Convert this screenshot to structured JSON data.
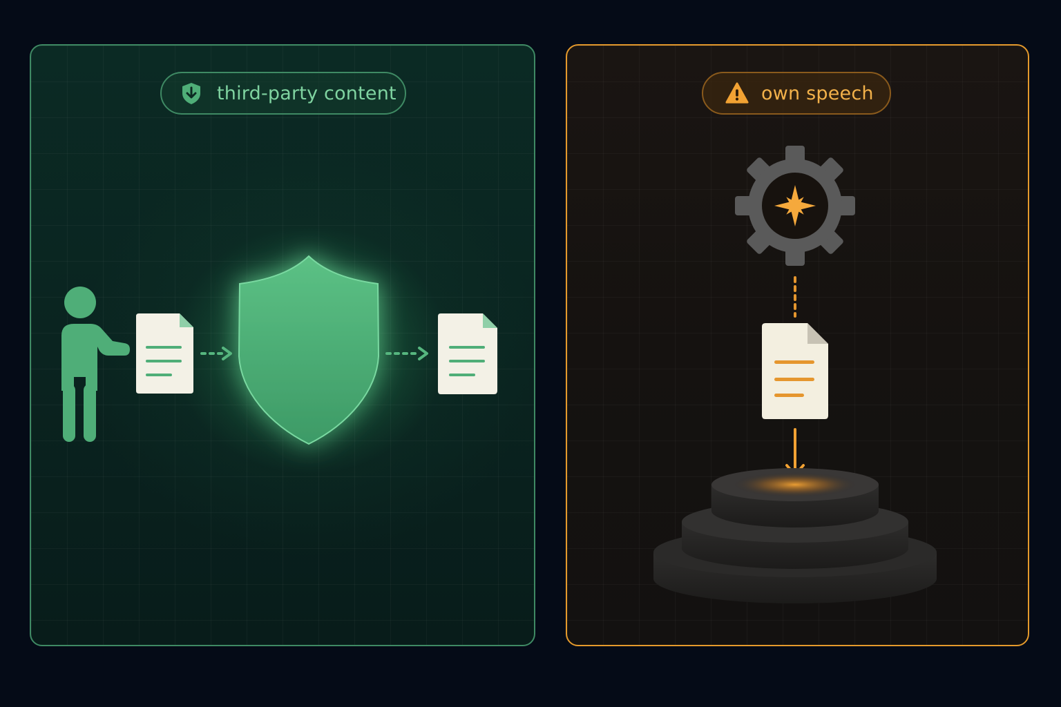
{
  "left_panel": {
    "label": "third-party content",
    "label_icon": "shield-download-icon",
    "accent": "#4fae78"
  },
  "right_panel": {
    "label": "own speech",
    "label_icon": "warning-triangle-icon",
    "accent": "#f2a233"
  }
}
